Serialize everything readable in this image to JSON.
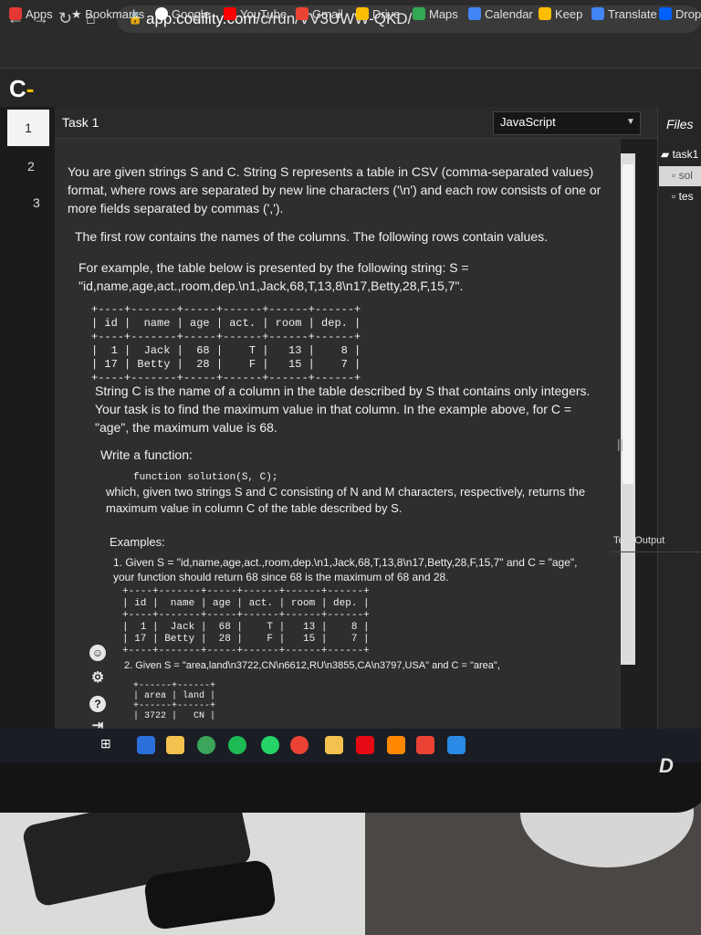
{
  "browser": {
    "url_host": "app.codility.com",
    "url_path": "/c/run/VV3UWW-QKD/",
    "bookmarks": [
      {
        "label": "Apps",
        "color": "#e53935"
      },
      {
        "label": "Bookmarks",
        "color": "#cccccc"
      },
      {
        "label": "Google",
        "color": "#ffffff"
      },
      {
        "label": "YouTube",
        "color": "#ff0000"
      },
      {
        "label": "Gmail",
        "color": "#ea4335"
      },
      {
        "label": "Drive",
        "color": "#fbbc04"
      },
      {
        "label": "Maps",
        "color": "#34a853"
      },
      {
        "label": "Calendar",
        "color": "#4285f4"
      },
      {
        "label": "Keep",
        "color": "#fbbc04"
      },
      {
        "label": "Translate",
        "color": "#4285f4"
      },
      {
        "label": "Dropb",
        "color": "#0061ff"
      }
    ]
  },
  "app": {
    "logo": "C",
    "tasks": [
      "1",
      "2",
      "3"
    ]
  },
  "task": {
    "title": "Task 1",
    "language": "JavaScript",
    "p1": "You are given strings S and C. String S represents a table in CSV (comma-separated values) format, where rows are separated by new line characters ('\\n') and each row consists of one or more fields separated by commas (',').",
    "p2": "The first row contains the names of the columns. The following rows contain values.",
    "p3": "For example, the table below is presented by the following string: S = \"id,name,age,act.,room,dep.\\n1,Jack,68,T,13,8\\n17,Betty,28,F,15,7\".",
    "table1": "+----+-------+-----+------+------+------+\n| id |  name | age | act. | room | dep. |\n+----+-------+-----+------+------+------+\n|  1 |  Jack |  68 |    T |   13 |    8 |\n| 17 | Betty |  28 |    F |   15 |    7 |\n+----+-------+-----+------+------+------+",
    "p4": "String C is the name of a column in the table described by S that contains only integers. Your task is to find the maximum value in that column. In the example above, for C = \"age\", the maximum value is 68.",
    "p5": "Write a function:",
    "code": "function solution(S, C);",
    "p6": "which, given two strings S and C consisting of N and M characters, respectively, returns the maximum value in column C of the table described by S.",
    "p7": "Examples:",
    "ex1": "1. Given S = \"id,name,age,act.,room,dep.\\n1,Jack,68,T,13,8\\n17,Betty,28,F,15,7\" and C = \"age\", your function should return 68 since 68 is the maximum of 68 and 28.",
    "table2": "+----+-------+-----+------+------+------+\n| id |  name | age | act. | room | dep. |\n+----+-------+-----+------+------+------+\n|  1 |  Jack |  68 |    T |   13 |    8 |\n| 17 | Betty |  28 |    F |   15 |    7 |\n+----+-------+-----+------+------+------+",
    "ex2": "2. Given S = \"area,land\\n3722,CN\\n6612,RU\\n3855,CA\\n3797,USA\" and C = \"area\",",
    "table3": "+------+------+\n| area | land |\n+------+------+\n| 3722 |   CN |"
  },
  "files": {
    "title": "Files",
    "folder": "task1",
    "items": [
      "sol",
      "tes"
    ]
  },
  "output": {
    "title": "Test Output"
  }
}
